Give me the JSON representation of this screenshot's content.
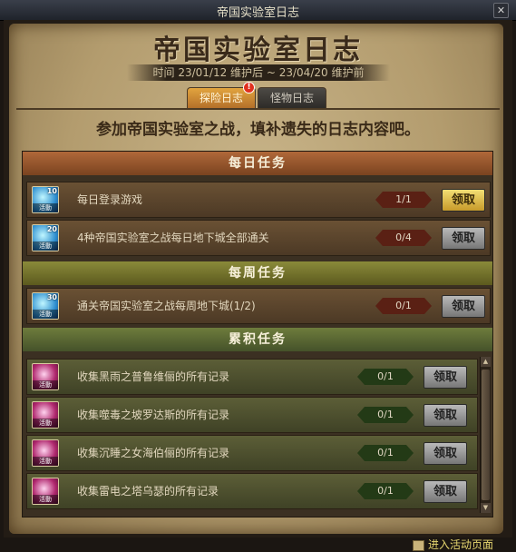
{
  "window": {
    "title": "帝国实验室日志",
    "close_glyph": "✕"
  },
  "header": {
    "title": "帝国实验室日志",
    "time_text": "时间  23/01/12 维护后 ~ 23/04/20 维护前"
  },
  "tabs": [
    {
      "label": "探险日志",
      "active": true
    },
    {
      "label": "怪物日志",
      "active": false
    }
  ],
  "alert_badge": "!",
  "subtitle": "参加帝国实验室之战，填补遗失的日志内容吧。",
  "sections": {
    "daily": {
      "title": "每日任务",
      "items": [
        {
          "icon": "activity-blue-icon",
          "icon_num": "10",
          "icon_label": "活動",
          "text": "每日登录游戏",
          "progress": "1/1",
          "button": "领取",
          "claimable": true
        },
        {
          "icon": "activity-blue-icon",
          "icon_num": "20",
          "icon_label": "活動",
          "text": "4种帝国实验室之战每日地下城全部通关",
          "progress": "0/4",
          "button": "领取",
          "claimable": false
        }
      ]
    },
    "weekly": {
      "title": "每周任务",
      "items": [
        {
          "icon": "activity-blue-icon",
          "icon_num": "30",
          "icon_label": "活動",
          "text": "通关帝国实验室之战每周地下城(1/2)",
          "progress": "0/1",
          "button": "领取",
          "claimable": false
        }
      ]
    },
    "cumulative": {
      "title": "累积任务",
      "items": [
        {
          "icon": "activity-pink-icon",
          "icon_label": "活動",
          "text": "收集黑雨之普鲁维俪的所有记录",
          "progress": "0/1",
          "button": "领取"
        },
        {
          "icon": "activity-pink-icon",
          "icon_label": "活動",
          "text": "收集噬毒之坡罗达斯的所有记录",
          "progress": "0/1",
          "button": "领取"
        },
        {
          "icon": "activity-pink-icon",
          "icon_label": "活動",
          "text": "收集沉睡之女海伯俪的所有记录",
          "progress": "0/1",
          "button": "领取"
        },
        {
          "icon": "activity-pink-icon",
          "icon_label": "活動",
          "text": "收集雷电之塔乌瑟的所有记录",
          "progress": "0/1",
          "button": "领取"
        }
      ]
    }
  },
  "footer": {
    "link_text": "进入活动页面"
  },
  "colors": {
    "accent_gold": "#e0b84a",
    "progress_red": "#5a2014",
    "progress_green": "#233a16"
  }
}
